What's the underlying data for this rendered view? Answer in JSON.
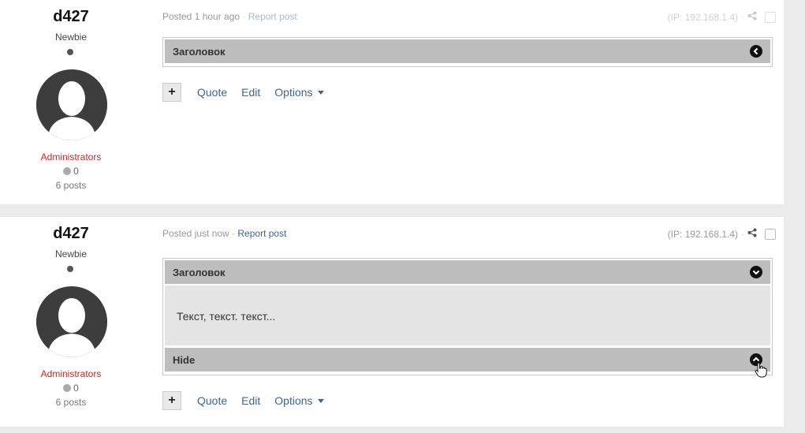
{
  "posts": [
    {
      "author": {
        "name": "d427",
        "rank": "Newbie",
        "group": "Administrators",
        "reputation": "0",
        "posts": "6 posts"
      },
      "meta": {
        "posted": "Posted 1 hour ago",
        "separator": " · ",
        "report": "Report post",
        "ip": "(IP: 192.168.1.4)"
      },
      "spoiler": {
        "title": "Заголовок",
        "state": "collapsed"
      },
      "actions": {
        "quote": "Quote",
        "edit": "Edit",
        "options": "Options",
        "plus": "+"
      }
    },
    {
      "author": {
        "name": "d427",
        "rank": "Newbie",
        "group": "Administrators",
        "reputation": "0",
        "posts": "6 posts"
      },
      "meta": {
        "posted": "Posted just now",
        "separator": " · ",
        "report": "Report post",
        "ip": "(IP: 192.168.1.4)"
      },
      "spoiler": {
        "title": "Заголовок",
        "body": "Текст, текст. текст...",
        "hide": "Hide",
        "state": "expanded"
      },
      "actions": {
        "quote": "Quote",
        "edit": "Edit",
        "options": "Options",
        "plus": "+"
      }
    }
  ],
  "colors": {
    "group": "#c62828",
    "link": "#3d6594",
    "spoiler_header": "#bdbdbd",
    "spoiler_body": "#e4e4e4"
  },
  "icons": [
    "share-icon",
    "chevron-left-icon",
    "chevron-down-icon",
    "chevron-up-icon",
    "hand-cursor-icon"
  ]
}
